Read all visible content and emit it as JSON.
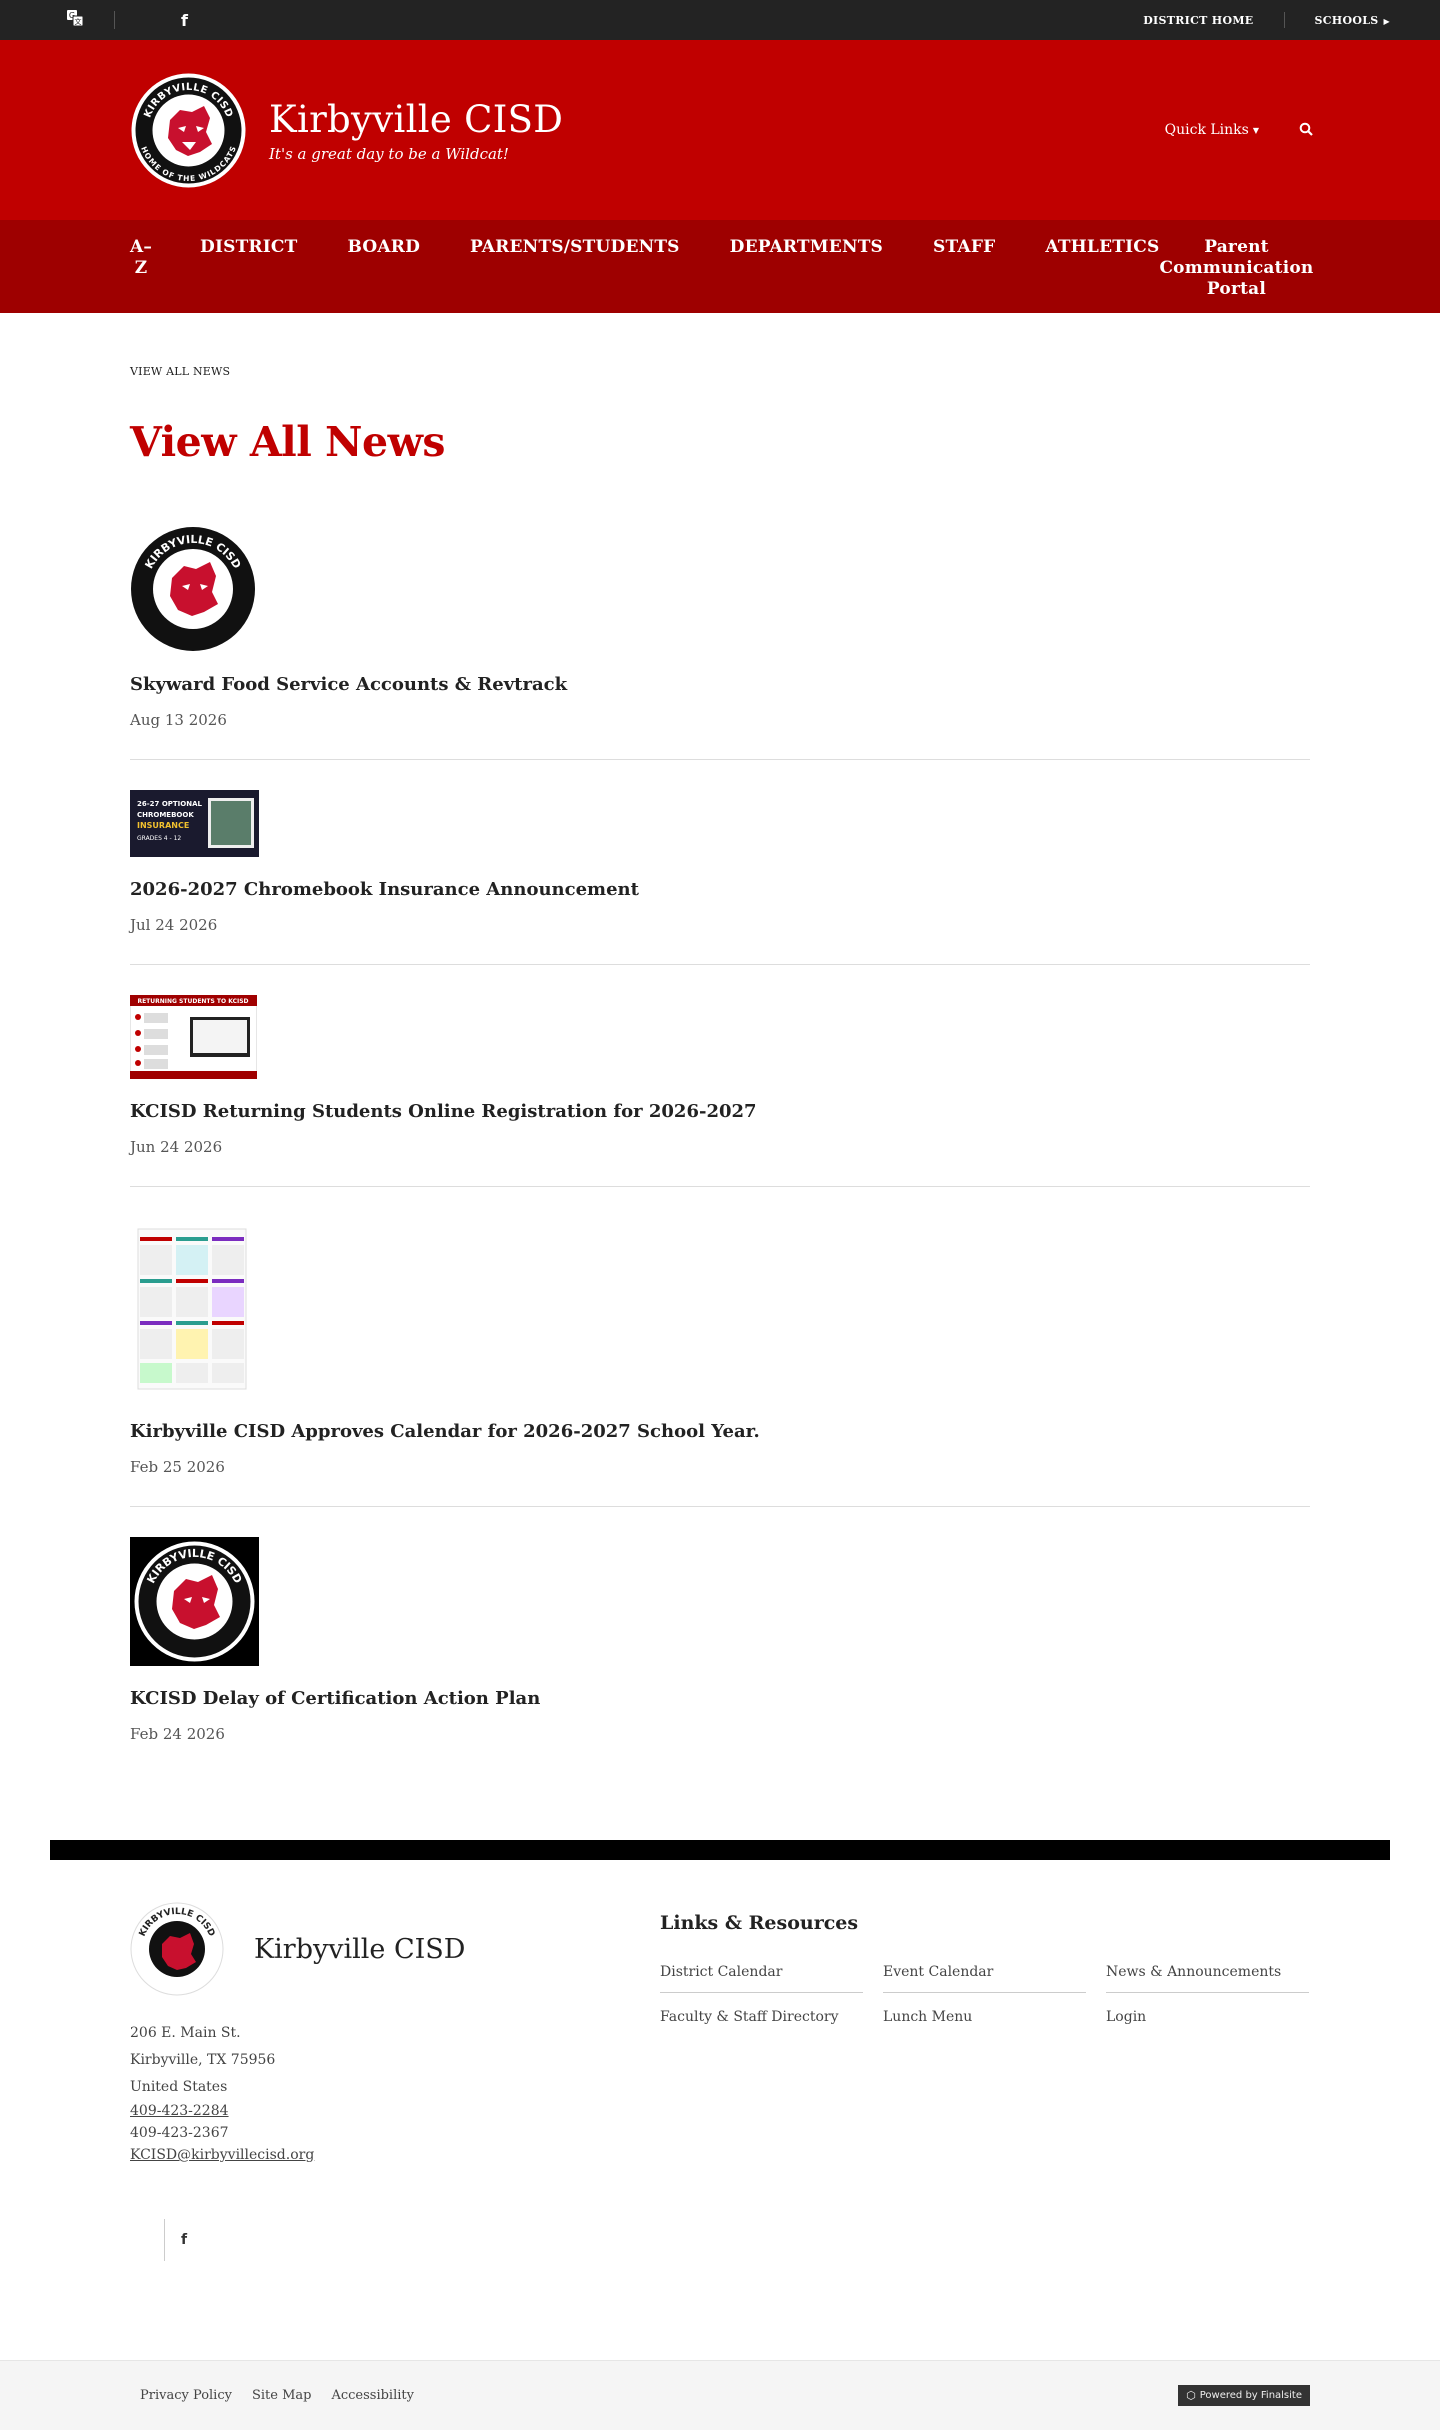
{
  "utility": {
    "translate_icon": "translate-icon",
    "facebook_glyph": "f",
    "district_home": "DISTRICT HOME",
    "schools": "SCHOOLS"
  },
  "header": {
    "site_name": "Kirbyville CISD",
    "tagline": "It's a great day to be a Wildcat!",
    "quick_links": "Quick Links",
    "logo_text_top": "KIRBYVILLE CISD",
    "logo_text_bottom": "HOME OF THE WILDCATS"
  },
  "nav": {
    "items": [
      {
        "label": "A–Z"
      },
      {
        "label": "DISTRICT"
      },
      {
        "label": "BOARD"
      },
      {
        "label": "PARENTS/STUDENTS"
      },
      {
        "label": "DEPARTMENTS"
      },
      {
        "label": "STAFF"
      },
      {
        "label": "ATHLETICS"
      },
      {
        "label": "Parent Communication Portal"
      }
    ]
  },
  "main": {
    "breadcrumb": "VIEW ALL NEWS",
    "title": "View All News",
    "news": [
      {
        "title": "Skyward Food Service Accounts & Revtrack",
        "date": "Aug 13 2026"
      },
      {
        "title": "2026-2027 Chromebook Insurance Announcement",
        "date": "Jul 24 2026"
      },
      {
        "title": "KCISD Returning Students Online Registration for 2026-2027",
        "date": "Jun 24 2026"
      },
      {
        "title": "Kirbyville CISD Approves Calendar for 2026-2027 School Year.",
        "date": "Feb 25 2026"
      },
      {
        "title": "KCISD Delay of Certification Action Plan",
        "date": "Feb 24 2026"
      }
    ],
    "thumb_text": {
      "chromebook_line1": "26-27 OPTIONAL",
      "chromebook_line2": "CHROMEBOOK",
      "chromebook_line3": "INSURANCE",
      "chromebook_line4": "GRADES 4 - 12",
      "registration_header": "RETURNING STUDENTS TO KCISD"
    }
  },
  "footer": {
    "name": "Kirbyville CISD",
    "address1": "206 E. Main St.",
    "address2": "Kirbyville, TX  75956",
    "country": "United States",
    "phone": "409-423-2284",
    "fax": "409-423-2367",
    "email": "KCISD@kirbyvillecisd.org",
    "links_title": "Links & Resources",
    "links": [
      {
        "label": "District Calendar"
      },
      {
        "label": "Event Calendar"
      },
      {
        "label": "News & Announcements"
      },
      {
        "label": "Faculty & Staff Directory"
      },
      {
        "label": "Lunch Menu"
      },
      {
        "label": "Login"
      }
    ]
  },
  "bottom": {
    "privacy": "Privacy Policy",
    "sitemap": "Site Map",
    "accessibility": "Accessibility",
    "powered": "Powered by Finalsite"
  },
  "colors": {
    "brand_red": "#c00000",
    "nav_red": "#9e0000",
    "utility_dark": "#232323"
  }
}
